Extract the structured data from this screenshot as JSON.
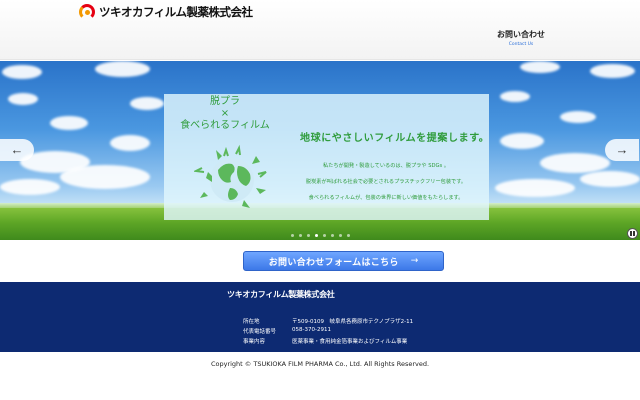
{
  "header": {
    "logo_text": "ツキオカフィルム製薬株式会社",
    "contact_label": "お問い合わせ",
    "contact_sub": "Contact Us"
  },
  "hero": {
    "title_lines": [
      "脱プラ",
      "×",
      "食べられるフィルム"
    ],
    "headline": "地球にやさしいフィルムを提案します。",
    "body_lines": [
      "私たちが開発・製造しているのは、脱プラや SDGs 。",
      "脱炭素が叫ばれる社会で必要とされるプラスチックフリー包装です。",
      "食べられるフィルムが、包装の世界に新しい価値をもたらします。"
    ],
    "slide_count": 8,
    "active_slide": 3,
    "prev_icon": "arrow-left-icon",
    "next_icon": "arrow-right-icon",
    "pause_icon": "pause-icon"
  },
  "cta": {
    "label": "お問い合わせフォームはこちら",
    "arrow": "→"
  },
  "footer": {
    "company": "ツキオカフィルム製薬株式会社",
    "info": [
      {
        "key": "所在地",
        "value": "〒509-0109　岐阜県各務原市テクノプラザ2-11"
      },
      {
        "key": "代表電話番号",
        "value": "058-370-2911"
      },
      {
        "key": "事業内容",
        "value": "医薬事業・食用純金箔事業およびフィルム事業"
      }
    ],
    "copyright": "Copyright © TSUKIOKA FILM PHARMA Co., Ltd. All Rights Reserved."
  },
  "colors": {
    "footer_bg": "#0d2a72",
    "cta": "#3c78e8",
    "green_text": "#2f9c3c"
  }
}
